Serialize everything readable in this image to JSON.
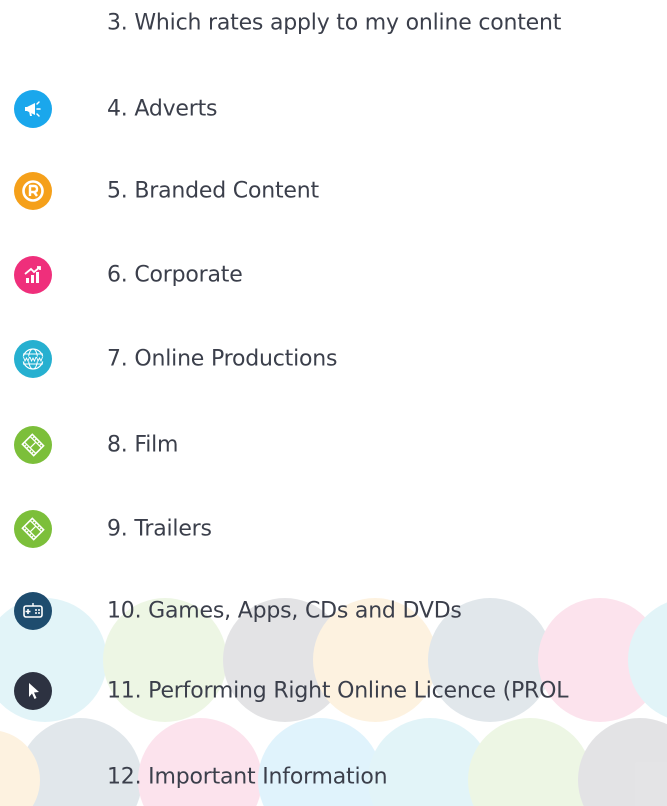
{
  "toc": {
    "items": [
      {
        "label": "3. Which rates apply to my online content",
        "icon": "none"
      },
      {
        "label": "4. Adverts",
        "icon": "megaphone-icon",
        "color": "#1aa7ec"
      },
      {
        "label": "5. Branded Content",
        "icon": "registered-icon",
        "color": "#f5a01a"
      },
      {
        "label": "6. Corporate",
        "icon": "chart-growth-icon",
        "color": "#ef2f7b"
      },
      {
        "label": "7. Online Productions",
        "icon": "www-globe-icon",
        "color": "#26b0d0"
      },
      {
        "label": "8. Film",
        "icon": "film-strip-icon",
        "color": "#7cbf3a"
      },
      {
        "label": "9. Trailers",
        "icon": "film-strip-icon",
        "color": "#7cbf3a"
      },
      {
        "label": "10. Games, Apps, CDs and DVDs",
        "icon": "gamepad-icon",
        "color": "#1e4c6e"
      },
      {
        "label": "11. Performing Right Online Licence (PROL",
        "icon": "cursor-arrow-icon",
        "color": "#2d3241"
      },
      {
        "label": "12. Important Information",
        "icon": "none"
      }
    ]
  },
  "colors": {
    "text": "#3b3f4b",
    "background": "#ffffff"
  }
}
